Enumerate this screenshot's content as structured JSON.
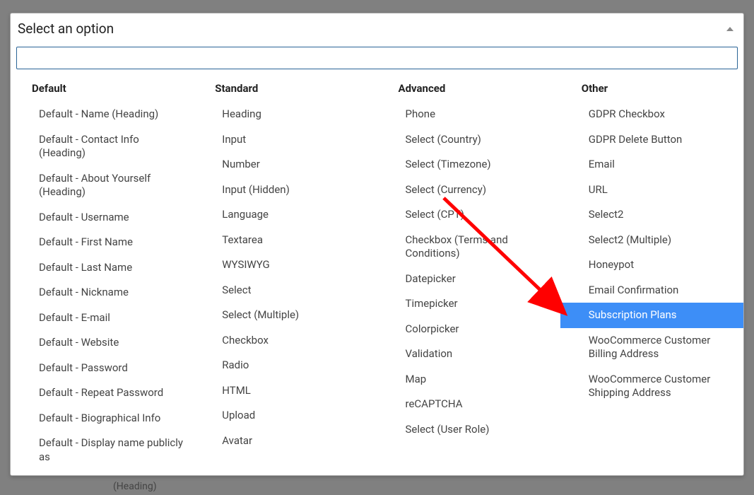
{
  "header": {
    "title": "Select an option"
  },
  "search": {
    "value": "",
    "placeholder": ""
  },
  "columns": [
    {
      "heading": "Default",
      "options": [
        "Default - Name (Heading)",
        "Default - Contact Info (Heading)",
        "Default - About Yourself (Heading)",
        "Default - Username",
        "Default - First Name",
        "Default - Last Name",
        "Default - Nickname",
        "Default - E-mail",
        "Default - Website",
        "Default - Password",
        "Default - Repeat Password",
        "Default - Biographical Info",
        "Default - Display name publicly as"
      ]
    },
    {
      "heading": "Standard",
      "options": [
        "Heading",
        "Input",
        "Number",
        "Input (Hidden)",
        "Language",
        "Textarea",
        "WYSIWYG",
        "Select",
        "Select (Multiple)",
        "Checkbox",
        "Radio",
        "HTML",
        "Upload",
        "Avatar"
      ]
    },
    {
      "heading": "Advanced",
      "options": [
        "Phone",
        "Select (Country)",
        "Select (Timezone)",
        "Select (Currency)",
        "Select (CPT)",
        "Checkbox (Terms and Conditions)",
        "Datepicker",
        "Timepicker",
        "Colorpicker",
        "Validation",
        "Map",
        "reCAPTCHA",
        "Select (User Role)"
      ]
    },
    {
      "heading": "Other",
      "options": [
        "GDPR Checkbox",
        "GDPR Delete Button",
        "Email",
        "URL",
        "Select2",
        "Select2 (Multiple)",
        "Honeypot",
        "Email Confirmation",
        "Subscription Plans",
        "WooCommerce Customer Billing Address",
        "WooCommerce Customer Shipping Address"
      ]
    }
  ],
  "highlighted": {
    "column": 3,
    "index": 8
  },
  "bg_text": "(Heading)",
  "arrow": {
    "from_option": "Select (Currency)",
    "to_option": "Subscription Plans"
  }
}
